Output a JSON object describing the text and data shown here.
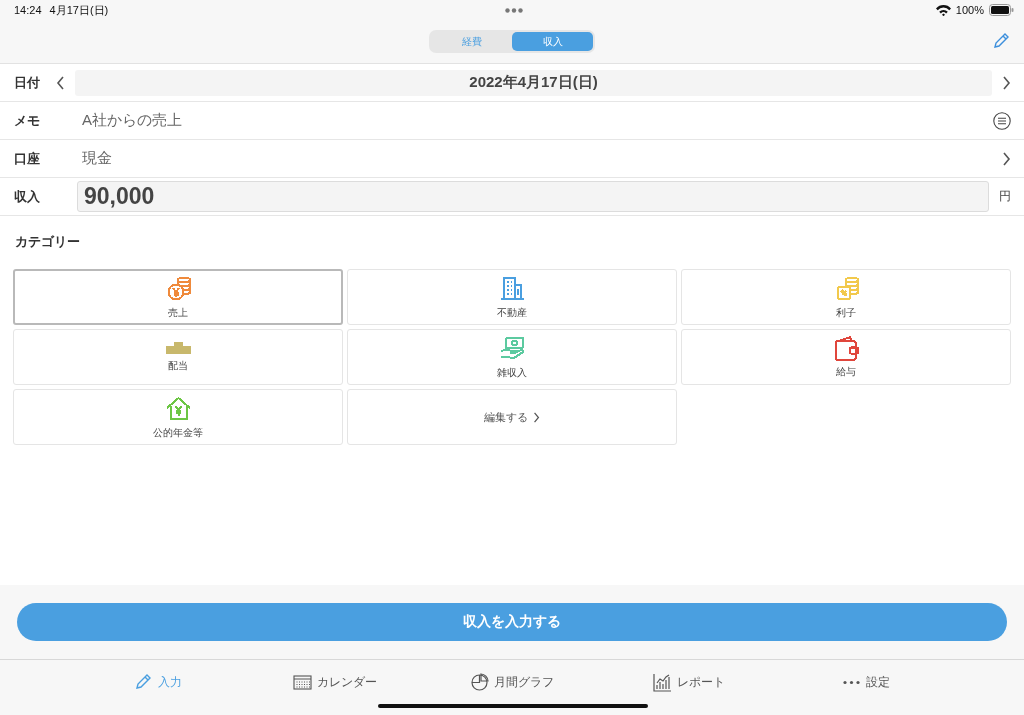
{
  "status_bar": {
    "time": "14:24",
    "date": "4月17日(日)",
    "battery": "100%"
  },
  "segments": [
    {
      "label": "経費",
      "selected": false
    },
    {
      "label": "収入",
      "selected": true
    }
  ],
  "form": {
    "date": {
      "label": "日付",
      "value": "2022年4月17日(日)"
    },
    "memo": {
      "label": "メモ",
      "value": "A社からの売上"
    },
    "account": {
      "label": "口座",
      "value": "現金"
    },
    "amount": {
      "label": "収入",
      "value": "90,000",
      "unit": "円"
    }
  },
  "category_heading": "カテゴリー",
  "categories": [
    {
      "label": "売上",
      "kind": "coins-yen",
      "color": "#ef8a3c",
      "selected": true
    },
    {
      "label": "不動産",
      "kind": "building",
      "color": "#4a9fe0",
      "selected": false
    },
    {
      "label": "利子",
      "kind": "coins-percent",
      "color": "#f2c94c",
      "selected": false
    },
    {
      "label": "配当",
      "kind": "coins-row",
      "color": "#c8b86c",
      "selected": false
    },
    {
      "label": "雑収入",
      "kind": "hand-cash",
      "color": "#5ccaa0",
      "selected": false
    },
    {
      "label": "給与",
      "kind": "wallet",
      "color": "#e0463c",
      "selected": false
    },
    {
      "label": "公的年金等",
      "kind": "house-yen",
      "color": "#6cc644",
      "selected": false
    }
  ],
  "edit_link": "編集する",
  "submit_button": "収入を入力する",
  "tab_bar": [
    {
      "label": "入力",
      "kind": "pencil",
      "selected": true
    },
    {
      "label": "カレンダー",
      "kind": "calendar",
      "selected": false
    },
    {
      "label": "月間グラフ",
      "kind": "pie",
      "selected": false
    },
    {
      "label": "レポート",
      "kind": "bars",
      "selected": false
    },
    {
      "label": "設定",
      "kind": "dots",
      "selected": false
    }
  ]
}
